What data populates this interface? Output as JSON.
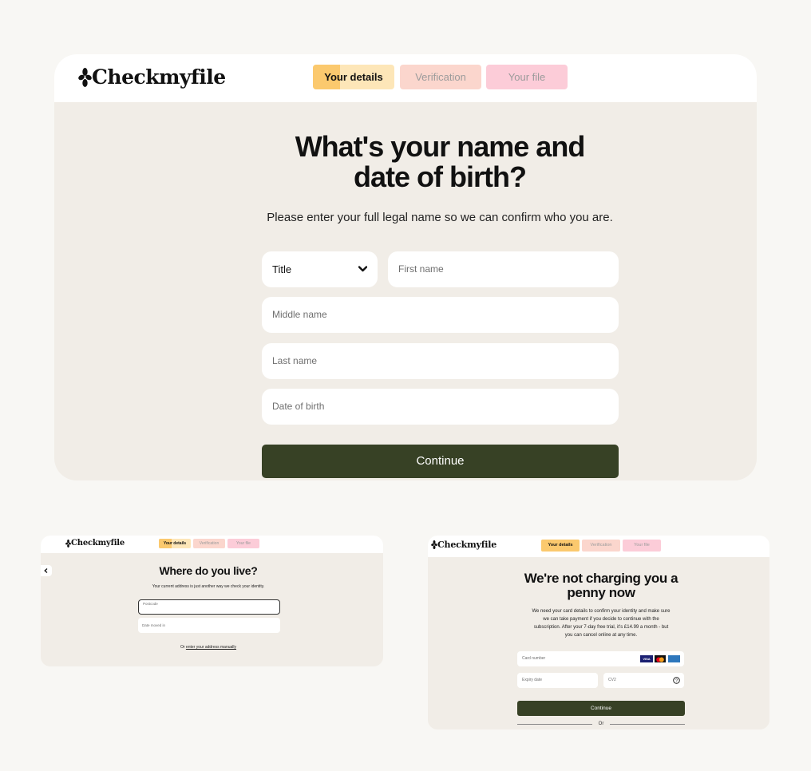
{
  "brand": {
    "logo_text": "Checkmyfile"
  },
  "steps": [
    "Your details",
    "Verification",
    "Your file"
  ],
  "screen1": {
    "heading": "What's your name and date of birth?",
    "subheading": "Please enter your full legal name so we can confirm who you are.",
    "title_select": "Title",
    "first_name": "First name",
    "middle_name": "Middle name",
    "last_name": "Last name",
    "dob": "Date of birth",
    "continue": "Continue"
  },
  "screen2": {
    "heading": "Where do you live?",
    "subheading": "Your current address is just another way we check your identity.",
    "postcode": "Postcode",
    "date_moved": "Date moved in",
    "or_text": "Or",
    "manual_link": "enter your address manually"
  },
  "screen3": {
    "heading": "We're not charging you a penny now",
    "body": "We need your card details to confirm your identity and make sure we can take payment if you decide to continue with the subscription. After your 7-day free trial, it's £14.99 a month - but you can cancel online at any time.",
    "card_number": "Card number",
    "expiry": "Expiry date",
    "cv2": "CV2",
    "card_brands": [
      "VISA",
      "MC",
      "AMEX"
    ],
    "continue": "Continue",
    "or_text": "Or"
  },
  "progress": {
    "your_details_fill": 0.33
  },
  "colors": {
    "page_bg": "#f8f7f4",
    "card_bg": "#f1ede7",
    "button": "#374125",
    "step1": "#fbc96e",
    "step2": "#fbd6cd",
    "step3": "#fcccd8"
  }
}
